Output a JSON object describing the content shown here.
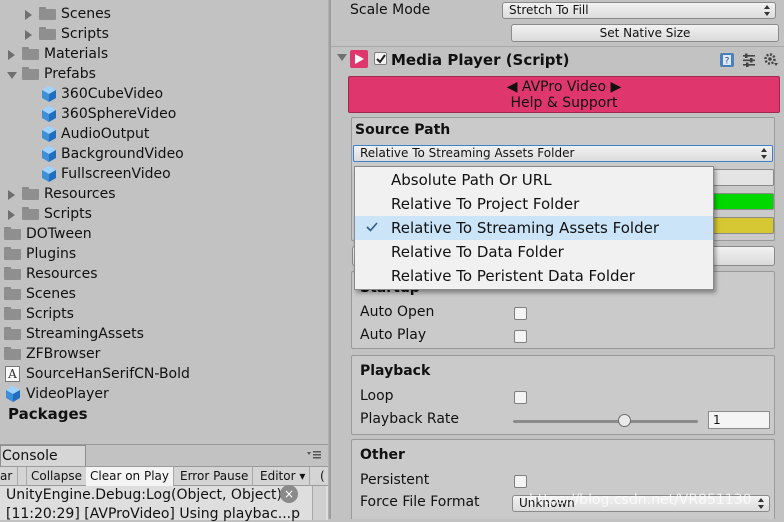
{
  "project": {
    "items": [
      {
        "label": "Scenes",
        "icon": "folder-icon",
        "expand": "collapsed"
      },
      {
        "label": "Scripts",
        "icon": "folder-icon",
        "expand": "collapsed"
      },
      {
        "label": "Materials",
        "icon": "folder-icon",
        "expand": "collapsed"
      },
      {
        "label": "Prefabs",
        "icon": "folder-icon",
        "expand": "expanded"
      },
      {
        "label": "360CubeVideo",
        "icon": "prefab-icon"
      },
      {
        "label": "360SphereVideo",
        "icon": "prefab-icon"
      },
      {
        "label": "AudioOutput",
        "icon": "prefab-icon"
      },
      {
        "label": "BackgroundVideo",
        "icon": "prefab-icon"
      },
      {
        "label": "FullscreenVideo",
        "icon": "prefab-icon"
      },
      {
        "label": "Resources",
        "icon": "folder-icon",
        "expand": "collapsed"
      },
      {
        "label": "Scripts",
        "icon": "folder-icon",
        "expand": "collapsed"
      },
      {
        "label": "DOTween",
        "icon": "folder-icon"
      },
      {
        "label": "Plugins",
        "icon": "folder-icon"
      },
      {
        "label": "Resources",
        "icon": "folder-icon"
      },
      {
        "label": "Scenes",
        "icon": "folder-icon"
      },
      {
        "label": "Scripts",
        "icon": "folder-icon"
      },
      {
        "label": "StreamingAssets",
        "icon": "folder-icon"
      },
      {
        "label": "ZFBrowser",
        "icon": "folder-icon"
      },
      {
        "label": "SourceHanSerifCN-Bold",
        "icon": "font-icon",
        "icon_glyph": "A"
      },
      {
        "label": "VideoPlayer",
        "icon": "prefab-icon"
      }
    ],
    "packages": "Packages"
  },
  "console": {
    "tab": "Console",
    "toolbar": [
      "ar",
      "Collapse",
      "Clear on Play",
      "Error Pause",
      "Editor ▾",
      "("
    ],
    "active_toolbar": [
      "Clear on Play"
    ],
    "lines": [
      "UnityEngine.Debug:Log(Object, Object)",
      "[11:20:29] [AVProVideo] Using playbac...p"
    ],
    "clear_glyph": "×"
  },
  "inspector": {
    "scale_mode": {
      "label": "Scale Mode",
      "value": "Stretch To Fill"
    },
    "set_native_size": "Set Native Size",
    "component": {
      "title": "Media Player (Script)",
      "enabled": true
    },
    "banner": {
      "line1": "◀ AVPro Video ▶",
      "line2": "Help & Support",
      "color": "#e0366e"
    },
    "source_path": {
      "title": "Source Path",
      "selected": "Relative To Streaming Assets Folder"
    },
    "status_colors": {
      "green": "#00d800",
      "yellow": "#d6c832"
    },
    "startup": {
      "title": "Startup",
      "auto_open": "Auto Open",
      "auto_play": "Auto Play"
    },
    "playback": {
      "title": "Playback",
      "loop": "Loop",
      "rate_label": "Playback Rate",
      "rate_value": "1",
      "rate_slider_fraction": 0.6
    },
    "other": {
      "title": "Other",
      "persistent": "Persistent",
      "force_format": "Force File Format",
      "force_format_value": "Unknown"
    },
    "watermark": "https://blog.csdn.net/VR851130"
  },
  "popup": {
    "options": [
      "Absolute Path Or URL",
      "Relative To Project Folder",
      "Relative To Streaming Assets Folder",
      "Relative To Data Folder",
      "Relative To Peristent Data Folder"
    ],
    "selected_index": 2
  }
}
